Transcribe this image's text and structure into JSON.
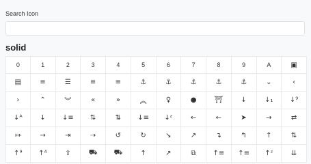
{
  "search": {
    "label": "Search Icon",
    "value": "",
    "placeholder": ""
  },
  "section": {
    "title": "solid"
  },
  "icons": [
    {
      "g": "0",
      "n": "digit-0-icon",
      "t": 1
    },
    {
      "g": "1",
      "n": "digit-1-icon",
      "t": 1
    },
    {
      "g": "2",
      "n": "digit-2-icon",
      "t": 1
    },
    {
      "g": "3",
      "n": "digit-3-icon",
      "t": 1
    },
    {
      "g": "4",
      "n": "digit-4-icon",
      "t": 1
    },
    {
      "g": "5",
      "n": "digit-5-icon",
      "t": 1
    },
    {
      "g": "6",
      "n": "digit-6-icon",
      "t": 1
    },
    {
      "g": "7",
      "n": "digit-7-icon",
      "t": 1
    },
    {
      "g": "8",
      "n": "digit-8-icon",
      "t": 1
    },
    {
      "g": "9",
      "n": "digit-9-icon",
      "t": 1
    },
    {
      "g": "A",
      "n": "letter-a-icon",
      "t": 1
    },
    {
      "g": "▣",
      "n": "address-book-icon"
    },
    {
      "g": "▤",
      "n": "address-card-icon"
    },
    {
      "g": "≡",
      "n": "align-center-icon"
    },
    {
      "g": "☰",
      "n": "align-justify-icon"
    },
    {
      "g": "≡",
      "n": "align-left-icon"
    },
    {
      "g": "≡",
      "n": "align-right-icon"
    },
    {
      "g": "⚓",
      "n": "anchor-icon"
    },
    {
      "g": "⚓",
      "n": "anchor-circle-check-icon"
    },
    {
      "g": "⚓",
      "n": "anchor-circle-exclamation-icon"
    },
    {
      "g": "⚓",
      "n": "anchor-circle-xmark-icon"
    },
    {
      "g": "⚓",
      "n": "anchor-lock-icon"
    },
    {
      "g": "⌄",
      "n": "angle-down-icon"
    },
    {
      "g": "‹",
      "n": "angle-left-icon"
    },
    {
      "g": "›",
      "n": "angle-right-icon"
    },
    {
      "g": "⌃",
      "n": "angle-up-icon"
    },
    {
      "g": "︾",
      "n": "angles-down-icon"
    },
    {
      "g": "«",
      "n": "angles-left-icon"
    },
    {
      "g": "»",
      "n": "angles-right-icon"
    },
    {
      "g": "︽",
      "n": "angles-up-icon"
    },
    {
      "g": "♀",
      "n": "ankh-icon"
    },
    {
      "g": "●",
      "n": "apple-whole-icon"
    },
    {
      "g": "⛩",
      "n": "archway-icon"
    },
    {
      "g": "↓",
      "n": "arrow-down-icon"
    },
    {
      "g": "↓₁",
      "n": "arrow-down-1-9-icon"
    },
    {
      "g": "↓⁹",
      "n": "arrow-down-9-1-icon"
    },
    {
      "g": "↓ᴬ",
      "n": "arrow-down-a-z-icon"
    },
    {
      "g": "↓",
      "n": "arrow-down-long-icon"
    },
    {
      "g": "↓≡",
      "n": "arrow-down-short-wide-icon"
    },
    {
      "g": "⇅",
      "n": "arrow-down-up-across-line-icon"
    },
    {
      "g": "⇅",
      "n": "arrow-down-up-lock-icon"
    },
    {
      "g": "↓≡",
      "n": "arrow-down-wide-short-icon"
    },
    {
      "g": "↓ᶻ",
      "n": "arrow-down-z-a-icon"
    },
    {
      "g": "←",
      "n": "arrow-left-icon"
    },
    {
      "g": "←",
      "n": "arrow-left-long-icon"
    },
    {
      "g": "➤",
      "n": "arrow-pointer-icon"
    },
    {
      "g": "→",
      "n": "arrow-right-icon"
    },
    {
      "g": "⇄",
      "n": "arrow-right-arrow-left-icon"
    },
    {
      "g": "↦",
      "n": "arrow-right-from-bracket-icon"
    },
    {
      "g": "→",
      "n": "arrow-right-long-icon"
    },
    {
      "g": "⇥",
      "n": "arrow-right-to-bracket-icon"
    },
    {
      "g": "⇢",
      "n": "arrow-right-to-city-icon"
    },
    {
      "g": "↺",
      "n": "arrow-rotate-left-icon"
    },
    {
      "g": "↻",
      "n": "arrow-rotate-right-icon"
    },
    {
      "g": "↘",
      "n": "arrow-trend-down-icon"
    },
    {
      "g": "↗",
      "n": "arrow-trend-up-icon"
    },
    {
      "g": "↴",
      "n": "arrow-turn-down-icon"
    },
    {
      "g": "↰",
      "n": "arrow-turn-up-icon"
    },
    {
      "g": "↑",
      "n": "arrow-up-icon"
    },
    {
      "g": "⇅",
      "n": "arrow-up-1-9-icon"
    },
    {
      "g": "↑⁹",
      "n": "arrow-up-9-1-icon"
    },
    {
      "g": "↑ᴬ",
      "n": "arrow-up-a-z-icon"
    },
    {
      "g": "⇧",
      "n": "arrow-up-from-bracket-icon"
    },
    {
      "g": "⛟",
      "n": "arrow-up-from-ground-water-icon"
    },
    {
      "g": "⛟",
      "n": "arrow-up-from-water-pump-icon"
    },
    {
      "g": "↑",
      "n": "arrow-up-long-icon"
    },
    {
      "g": "↗",
      "n": "arrow-up-right-dots-icon"
    },
    {
      "g": "⧉",
      "n": "arrow-up-right-from-square-icon"
    },
    {
      "g": "↑≡",
      "n": "arrow-up-short-wide-icon"
    },
    {
      "g": "↑≡",
      "n": "arrow-up-wide-short-icon"
    },
    {
      "g": "↑ᶻ",
      "n": "arrow-up-z-a-icon"
    },
    {
      "g": "⇊",
      "n": "arrows-down-to-line-icon"
    }
  ]
}
